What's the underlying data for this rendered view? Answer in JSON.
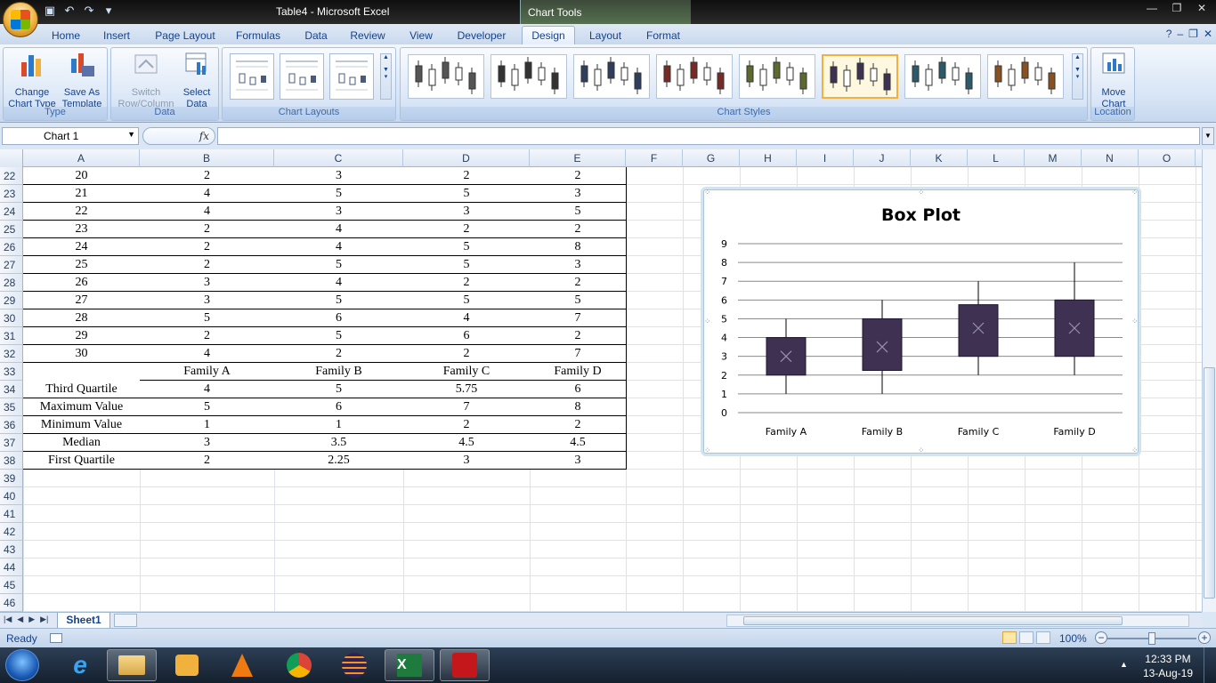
{
  "window": {
    "title": "Table4 - Microsoft Excel",
    "context_tab": "Chart Tools"
  },
  "ribbon": {
    "tabs": [
      "Home",
      "Insert",
      "Page Layout",
      "Formulas",
      "Data",
      "Review",
      "View",
      "Developer",
      "Design",
      "Layout",
      "Format"
    ],
    "active_tab": "Design",
    "groups": {
      "type": {
        "label": "Type",
        "change_chart_type": [
          "Change",
          "Chart Type"
        ],
        "save_as_template": [
          "Save As",
          "Template"
        ]
      },
      "data": {
        "label": "Data",
        "switch_row_column": [
          "Switch",
          "Row/Column"
        ],
        "select_data": [
          "Select",
          "Data"
        ]
      },
      "chart_layouts": {
        "label": "Chart Layouts"
      },
      "chart_styles": {
        "label": "Chart Styles",
        "selected_index": 5
      },
      "location": {
        "label": "Location",
        "move_chart": [
          "Move",
          "Chart"
        ]
      }
    }
  },
  "formula_bar": {
    "name_box": "Chart 1",
    "fx": "fx",
    "value": ""
  },
  "sheet": {
    "columns": [
      "A",
      "B",
      "C",
      "D",
      "E",
      "F",
      "G",
      "H",
      "I",
      "J",
      "K",
      "L",
      "M",
      "N",
      "O"
    ],
    "row_numbers": [
      "22",
      "23",
      "24",
      "25",
      "26",
      "27",
      "28",
      "29",
      "30",
      "31",
      "32",
      "33",
      "34",
      "35",
      "36",
      "37",
      "38",
      "39",
      "40",
      "41",
      "42",
      "43",
      "44",
      "45",
      "46"
    ],
    "data_rows": [
      [
        "20",
        "2",
        "3",
        "2",
        "2"
      ],
      [
        "21",
        "4",
        "5",
        "5",
        "3"
      ],
      [
        "22",
        "4",
        "3",
        "3",
        "5"
      ],
      [
        "23",
        "2",
        "4",
        "2",
        "2"
      ],
      [
        "24",
        "2",
        "4",
        "5",
        "8"
      ],
      [
        "25",
        "2",
        "5",
        "5",
        "3"
      ],
      [
        "26",
        "3",
        "4",
        "2",
        "2"
      ],
      [
        "27",
        "3",
        "5",
        "5",
        "5"
      ],
      [
        "28",
        "5",
        "6",
        "4",
        "7"
      ],
      [
        "29",
        "2",
        "5",
        "6",
        "2"
      ],
      [
        "30",
        "4",
        "2",
        "2",
        "7"
      ],
      [
        "",
        "Family A",
        "Family B",
        "Family C",
        "Family D"
      ],
      [
        "Third Quartile",
        "4",
        "5",
        "5.75",
        "6"
      ],
      [
        "Maximum Value",
        "5",
        "6",
        "7",
        "8"
      ],
      [
        "Minimum Value",
        "1",
        "1",
        "2",
        "2"
      ],
      [
        "Median",
        "3",
        "3.5",
        "4.5",
        "4.5"
      ],
      [
        "First Quartile",
        "2",
        "2.25",
        "3",
        "3"
      ]
    ],
    "tab_name": "Sheet1"
  },
  "chart_data": {
    "type": "box",
    "title": "Box Plot",
    "categories": [
      "Family A",
      "Family B",
      "Family C",
      "Family D"
    ],
    "min": [
      1,
      1,
      2,
      2
    ],
    "q1": [
      2,
      2.25,
      3,
      3
    ],
    "median": [
      3,
      3.5,
      4.5,
      4.5
    ],
    "q3": [
      4,
      5,
      5.75,
      6
    ],
    "max": [
      5,
      6,
      7,
      8
    ],
    "ylim": [
      0,
      9
    ],
    "yticks": [
      "0",
      "1",
      "2",
      "3",
      "4",
      "5",
      "6",
      "7",
      "8",
      "9"
    ],
    "grid": true,
    "box_color": "#3f3151",
    "marker_color": "#9a8fb0"
  },
  "status": {
    "text": "Ready",
    "zoom": "100%",
    "zoom_fraction": 0.5
  },
  "taskbar": {
    "time": "12:33 PM",
    "date": "13-Aug-19"
  }
}
